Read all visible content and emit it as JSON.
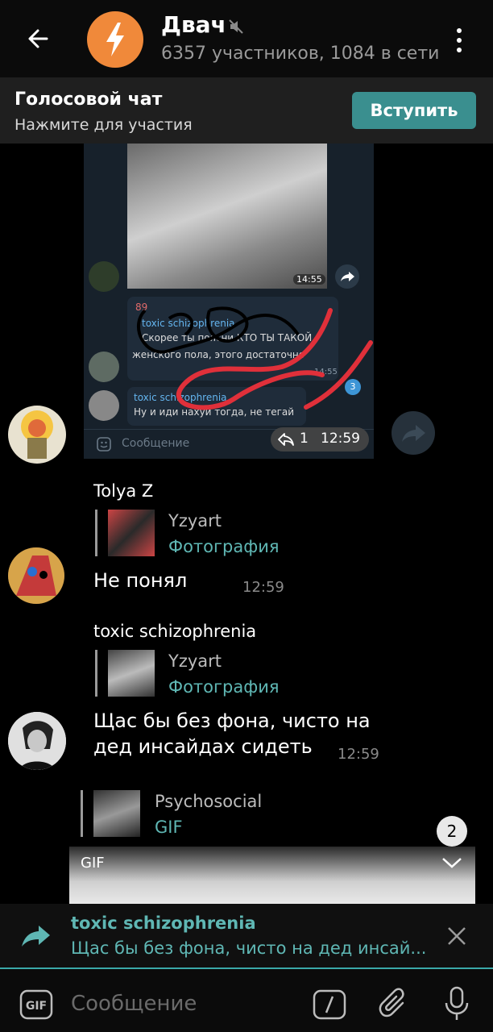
{
  "header": {
    "back_icon": "arrow-left-icon",
    "title": "Двач",
    "subtitle": "6357 участников, 1084 в сети",
    "mute_icon": "speaker-muted-icon",
    "menu_icon": "more-vertical-icon",
    "avatar_color": "#f0893a"
  },
  "voice_chat": {
    "title": "Голосовой чат",
    "subtitle": "Нажмите для участия",
    "join_label": "Вступить",
    "accent": "#3a8f8f"
  },
  "embedded_screenshot": {
    "photo_time": "14:55",
    "bubble1_number": "89",
    "bubble1_name": "toxic schizophrenia",
    "bubble1_quote": "Скорее ты поясни КТО ТЫ ТАКОЙ",
    "bubble1_text": "женского пола, этого достаточно",
    "bubble1_time": "14:55",
    "bubble2_name": "toxic schizophrenia",
    "bubble2_text": "Ну и иди нахуй тогда, не тегай",
    "badge": "3",
    "input_placeholder": "Сообщение",
    "reply_count": "1",
    "time": "12:59"
  },
  "messages": [
    {
      "author": "Tolya Z",
      "reply_author": "Yzyart",
      "reply_kind": "Фотография",
      "text": "Не понял",
      "time": "12:59"
    },
    {
      "author": "toxic schizophrenia",
      "reply_author": "Yzyart",
      "reply_kind": "Фотография",
      "text_line1": "Щас бы без фона, чисто на",
      "text_line2": "дед инсайдах сидеть",
      "time": "12:59"
    },
    {
      "reply_author": "Psychosocial",
      "reply_kind": "GIF",
      "gif_label": "GIF"
    }
  ],
  "scroll_badge": "2",
  "reply_bar": {
    "name": "toxic schizophrenia",
    "text": "Щас бы без фона, чисто на дед инсай...",
    "close_icon": "close-icon",
    "accent": "#5fb7b4"
  },
  "composer": {
    "placeholder": "Сообщение",
    "gif_label": "GIF"
  }
}
